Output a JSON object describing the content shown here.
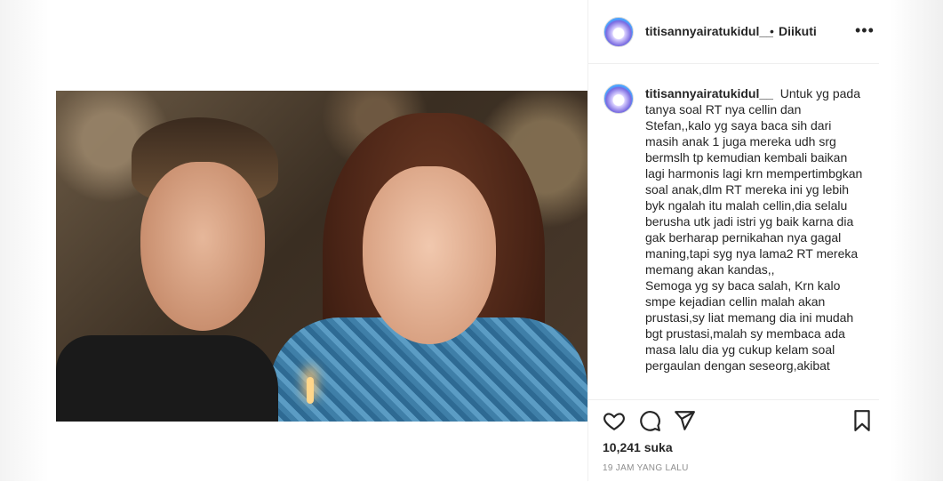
{
  "post": {
    "username": "titisannyairatukidul__",
    "separator": "•",
    "follow_label": "Diikuti",
    "more_icon": "more-horizontal-icon",
    "caption": "Untuk yg pada tanya soal RT nya cellin dan Stefan,,kalo yg saya baca sih dari masih anak 1 juga mereka udh srg bermslh tp kemudian kembali baikan lagi harmonis lagi krn mempertimbgkan soal anak,dlm RT mereka ini yg lebih byk ngalah itu malah cellin,dia selalu berusha utk jadi istri yg baik karna dia gak berharap pernikahan nya gagal maning,tapi syg nya lama2 RT mereka memang akan kandas,,\nSemoga yg sy baca salah, Krn kalo smpe kejadian cellin malah akan prustasi,sy liat memang dia ini mudah bgt prustasi,malah sy membaca ada masa lalu dia yg cukup kelam soal pergaulan dengan seseorg,akibat",
    "likes": "10,241 suka",
    "timestamp": "19 JAM YANG LALU"
  },
  "icons": {
    "like": "heart-icon",
    "comment": "comment-icon",
    "share": "send-icon",
    "save": "bookmark-icon"
  },
  "colors": {
    "text": "#262626",
    "muted": "#8e8e8e",
    "border": "#efefef"
  }
}
